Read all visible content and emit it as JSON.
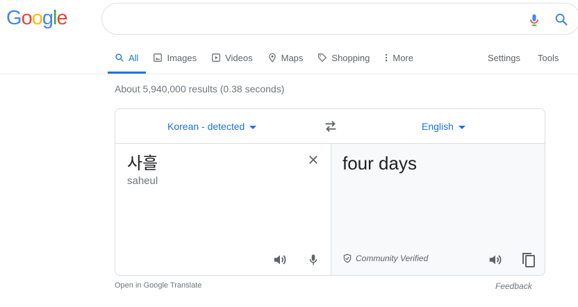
{
  "logo": {
    "letters": [
      "G",
      "o",
      "o",
      "g",
      "l",
      "e"
    ],
    "colors": [
      "#4285F4",
      "#EA4335",
      "#FBBC05",
      "#4285F4",
      "#34A853",
      "#EA4335"
    ]
  },
  "search": {
    "value": "",
    "placeholder": ""
  },
  "tabs": [
    {
      "label": "All",
      "icon": "search-icon",
      "active": true
    },
    {
      "label": "Images",
      "icon": "image-icon"
    },
    {
      "label": "Videos",
      "icon": "video-icon"
    },
    {
      "label": "Maps",
      "icon": "map-pin-icon"
    },
    {
      "label": "Shopping",
      "icon": "tag-icon"
    },
    {
      "label": "More",
      "icon": "more-vert-icon"
    }
  ],
  "tools": {
    "settings": "Settings",
    "tools": "Tools"
  },
  "stats": "About 5,940,000 results (0.38 seconds)",
  "translate": {
    "source_lang": "Korean - detected",
    "target_lang": "English",
    "source_text": "사흘",
    "transliteration": "saheul",
    "target_text": "four days",
    "verified_label": "Community Verified"
  },
  "footer": {
    "open_link": "Open in Google Translate",
    "feedback": "Feedback"
  },
  "colors": {
    "accent": "#1a73e8",
    "muted": "#70757a"
  }
}
